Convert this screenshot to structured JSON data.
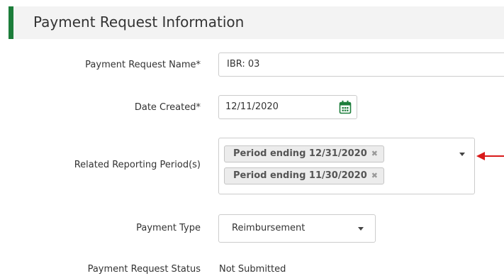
{
  "section": {
    "title": "Payment Request Information"
  },
  "form": {
    "name_label": "Payment Request Name*",
    "name_value": "IBR: 03",
    "date_label": "Date Created*",
    "date_value": "12/11/2020",
    "period_label": "Related Reporting Period(s)",
    "periods": [
      "Period ending 12/31/2020",
      "Period ending 11/30/2020"
    ],
    "type_label": "Payment Type",
    "type_value": "Reimbursement",
    "status_label": "Payment Request Status",
    "status_value": "Not Submitted"
  },
  "icons": {
    "calendar": "calendar-icon",
    "remove": "close-icon",
    "dropdown": "chevron-down-icon"
  },
  "colors": {
    "accent": "#1c7d3a",
    "annotation_arrow": "#d91a1a"
  }
}
